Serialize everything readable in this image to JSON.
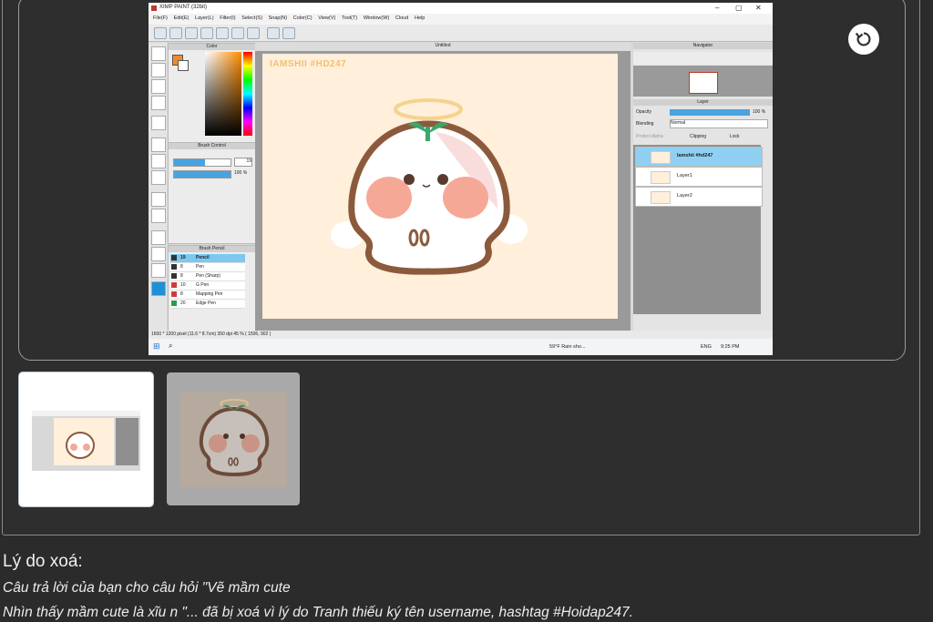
{
  "viewer": {
    "rotate_icon": "rotate-icon",
    "screenshot": {
      "window_title": "XIMP PAINT (32bit)",
      "menu": [
        "File(F)",
        "Edit(E)",
        "Layer(L)",
        "Filter(I)",
        "Select(S)",
        "Snap(N)",
        "Color(C)",
        "View(V)",
        "Tool(T)",
        "Window(W)",
        "Cloud",
        "Help"
      ],
      "color_panel_title": "Color",
      "brush_control_title": "Brush Control",
      "brush_size": "19",
      "brush_opacity": "100 %",
      "brush_pencil_title": "Brush Pencil",
      "pens": [
        {
          "size": "19",
          "name": "Pencil",
          "color": "#333333"
        },
        {
          "size": "8",
          "name": "Pen",
          "color": "#333333"
        },
        {
          "size": "8",
          "name": "Pen (Sharp)",
          "color": "#333333"
        },
        {
          "size": "10",
          "name": "G Pen",
          "color": "#d23b3b"
        },
        {
          "size": "8",
          "name": "Mapping Pen",
          "color": "#d23b3b"
        },
        {
          "size": "20",
          "name": "Edge Pen",
          "color": "#2e9b4a"
        }
      ],
      "canvas_title": "Untitled",
      "watermark": "IAMSHII #HD247",
      "navigator_title": "Navigator",
      "layer_title": "Layer",
      "opacity_label": "Opacity",
      "opacity_value": "100 %",
      "blending_label": "Blending",
      "blending_value": "Normal",
      "protect_alpha": "Protect Alpha",
      "clipping": "Clipping",
      "lock": "Lock",
      "layers": [
        "Iamshii #hd247",
        "Layer1",
        "Layer2"
      ],
      "status_text": "1600 * 1200 pixel  (11.6 * 8.7cm)  350 dpi  45 %  ( 1506, 902 )",
      "weather": "59°F  Rain sho...",
      "lang": "ENG",
      "clock": "9:25 PM"
    }
  },
  "thumbnails": [
    {
      "name": "thumbnail-1",
      "selected": true
    },
    {
      "name": "thumbnail-2",
      "selected": false
    }
  ],
  "deletion": {
    "title": "Lý do xoá:",
    "line1": "Câu trả lời của bạn cho câu hỏi \"Vẽ mầm cute",
    "line2": "Nhìn thấy mầm cute là xĩu n \"... đã bị xoá vì lý do Tranh thiếu ký tên username, hashtag #Hoidap247."
  },
  "colors": {
    "background": "#2b2b2b",
    "canvas": "#ffefdb",
    "character_outline": "#8b5a3c",
    "blush": "#f6a897",
    "halo": "#f5c77e",
    "sprout": "#3aa86a"
  }
}
